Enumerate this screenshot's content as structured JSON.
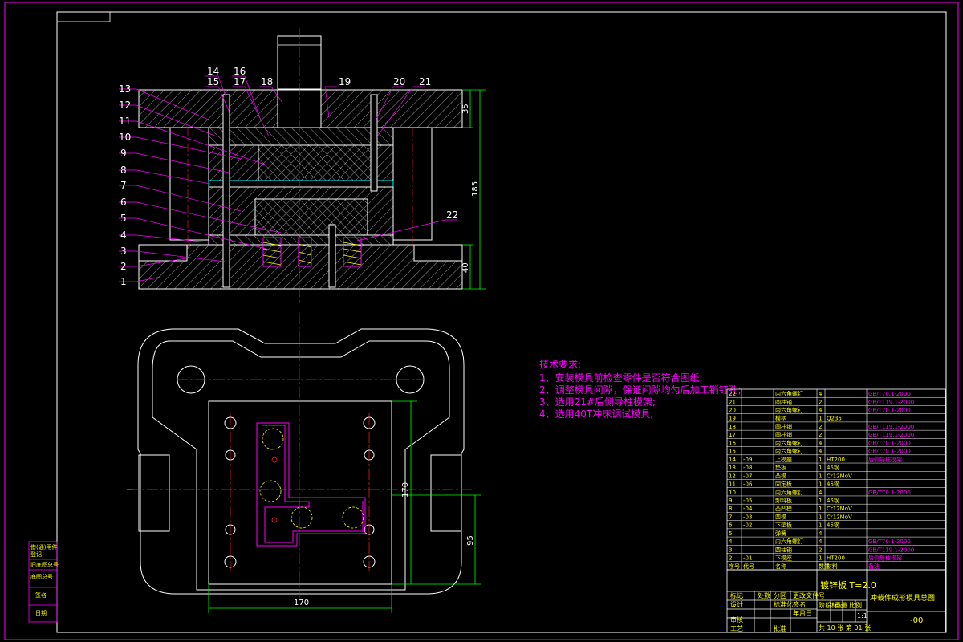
{
  "colors": {
    "background": "#000000",
    "frame": "#ff00ff",
    "line": "#ffffff",
    "centerline": "#ff2020",
    "dimension": "#00ff00",
    "yellow": "#ffff00",
    "cyan": "#00ffff"
  },
  "part_numbers": [
    "1",
    "2",
    "3",
    "4",
    "5",
    "6",
    "7",
    "8",
    "9",
    "10",
    "11",
    "12",
    "13",
    "14",
    "15",
    "16",
    "17",
    "18",
    "19",
    "20",
    "21",
    "22"
  ],
  "dimensions": {
    "plate_top": "35",
    "total_height": "185",
    "plate_bottom": "40",
    "plan_width": "170",
    "plan_height": "170",
    "plan_offset": "95"
  },
  "tech_requirements": {
    "title": "技术要求:",
    "items": [
      "1、安装模具前检查零件是否符合图纸;",
      "2、调整模具间隙，保证间隙均匀后加工销钉孔;",
      "3、选用21#后侧导柱模架;",
      "4、选用40T冲床调试模具;"
    ]
  },
  "bom": [
    {
      "no": "22",
      "code": "",
      "name": "内六角螺钉",
      "qty": "4",
      "mat": "",
      "std": "GB/T70.1-2000"
    },
    {
      "no": "21",
      "code": "",
      "name": "圆柱销",
      "qty": "2",
      "mat": "",
      "std": "GB/T119.1-2000"
    },
    {
      "no": "20",
      "code": "",
      "name": "内六角螺钉",
      "qty": "4",
      "mat": "",
      "std": "GB/T70.1-2000"
    },
    {
      "no": "19",
      "code": "",
      "name": "模柄",
      "qty": "1",
      "mat": "Q235",
      "std": ""
    },
    {
      "no": "18",
      "code": "",
      "name": "圆柱销",
      "qty": "2",
      "mat": "",
      "std": "GB/T119.1-2000"
    },
    {
      "no": "17",
      "code": "",
      "name": "圆柱销",
      "qty": "2",
      "mat": "",
      "std": "GB/T119.1-2000"
    },
    {
      "no": "16",
      "code": "",
      "name": "内六角螺钉",
      "qty": "4",
      "mat": "",
      "std": "GB/T70.1-2000"
    },
    {
      "no": "15",
      "code": "",
      "name": "内六角螺钉",
      "qty": "4",
      "mat": "",
      "std": "GB/T70.1-2000"
    },
    {
      "no": "14",
      "code": "-09",
      "name": "上模座",
      "qty": "1",
      "mat": "HT200",
      "std": "后侧导柱模架"
    },
    {
      "no": "13",
      "code": "-08",
      "name": "垫板",
      "qty": "1",
      "mat": "45钢",
      "std": ""
    },
    {
      "no": "12",
      "code": "-07",
      "name": "凸模",
      "qty": "1",
      "mat": "Cr12MoV",
      "std": ""
    },
    {
      "no": "11",
      "code": "-06",
      "name": "固定板",
      "qty": "1",
      "mat": "45钢",
      "std": ""
    },
    {
      "no": "10",
      "code": "",
      "name": "内六角螺钉",
      "qty": "4",
      "mat": "",
      "std": "GB/T70.1-2000"
    },
    {
      "no": "9",
      "code": "-05",
      "name": "卸料板",
      "qty": "1",
      "mat": "45钢",
      "std": ""
    },
    {
      "no": "8",
      "code": "-04",
      "name": "凸凹模",
      "qty": "1",
      "mat": "Cr12MoV",
      "std": ""
    },
    {
      "no": "7",
      "code": "-03",
      "name": "凹模",
      "qty": "1",
      "mat": "Cr12MoV",
      "std": ""
    },
    {
      "no": "6",
      "code": "-02",
      "name": "下垫板",
      "qty": "1",
      "mat": "45钢",
      "std": ""
    },
    {
      "no": "5",
      "code": "",
      "name": "弹簧",
      "qty": "4",
      "mat": "",
      "std": ""
    },
    {
      "no": "4",
      "code": "",
      "name": "内六角螺钉",
      "qty": "4",
      "mat": "",
      "std": "GB/T70.1-2000"
    },
    {
      "no": "3",
      "code": "",
      "name": "圆柱销",
      "qty": "2",
      "mat": "",
      "std": "GB/T119.1-2000"
    },
    {
      "no": "2",
      "code": "-01",
      "name": "下模座",
      "qty": "1",
      "mat": "HT200",
      "std": "后侧导柱模架"
    }
  ],
  "bom_header": {
    "no": "序号",
    "code": "代号",
    "name": "名称",
    "qty": "数量",
    "mat": "材料",
    "std": "备注"
  },
  "title_block": {
    "material": "镀锌板 T=2.0",
    "drawing_title": "冲裁件成形模具总图",
    "drawing_number": "-00",
    "scale": "1:1",
    "sheets": "共 10 张  第 01 张",
    "labels": [
      "标记",
      "处数",
      "分区",
      "更改文件号",
      "签名",
      "年月日",
      "设计",
      "标准化",
      "审核",
      "工艺",
      "批准",
      "阶段标记",
      "重量",
      "比例"
    ]
  },
  "left_stamp": [
    "借(通)用件",
    "登记",
    "旧底图总号",
    "底图总号",
    "签名",
    "日期"
  ]
}
